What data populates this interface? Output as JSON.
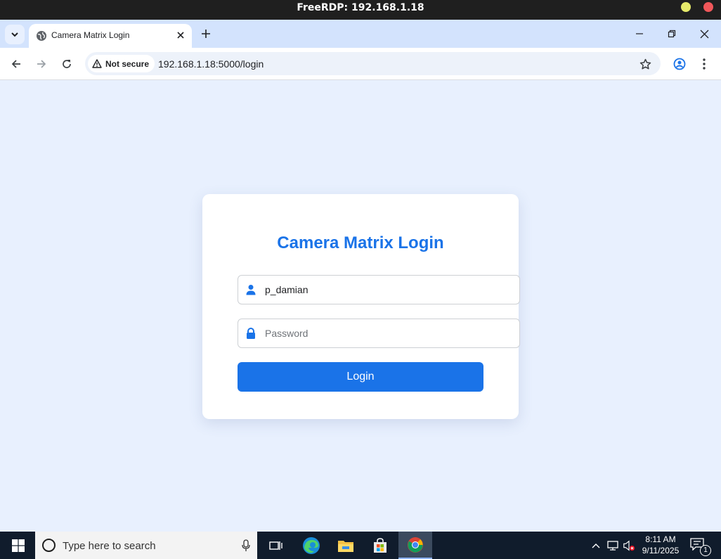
{
  "rdp": {
    "title": "FreeRDP: 192.168.1.18"
  },
  "browser": {
    "tab_title": "Camera Matrix Login",
    "security_label": "Not secure",
    "url": "192.168.1.18:5000/login"
  },
  "login": {
    "title": "Camera Matrix Login",
    "username_value": "p_damian",
    "password_placeholder": "Password",
    "button_label": "Login"
  },
  "taskbar": {
    "search_placeholder": "Type here to search",
    "time": "8:11 AM",
    "date": "9/11/2025",
    "notification_count": "1"
  },
  "icons": {
    "user": "user-icon",
    "lock": "lock-icon",
    "warning": "warning-icon",
    "star": "star-icon"
  },
  "colors": {
    "accent": "#1a73e8",
    "page_background": "#e8f0fe",
    "taskbar": "#101c2c"
  }
}
